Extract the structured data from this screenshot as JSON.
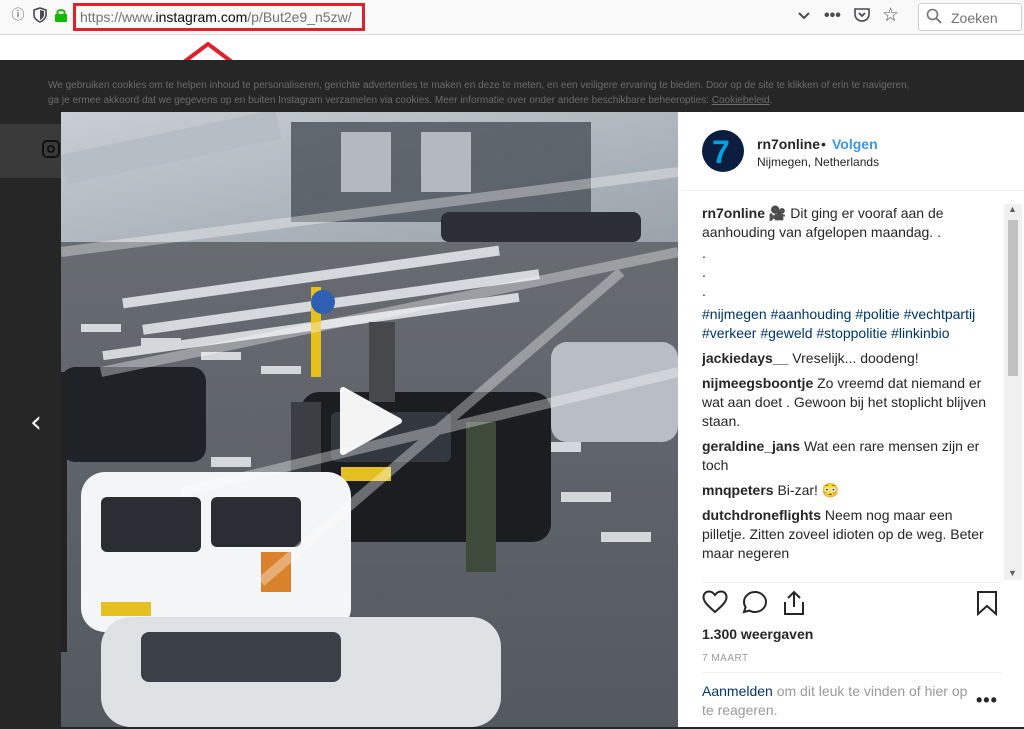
{
  "browser": {
    "url_prefix": "https://www.",
    "url_domain": "instagram.com",
    "url_path": "/p/But2e9_n5zw/",
    "search_placeholder": "Zoeken"
  },
  "cookie_banner": {
    "line1": "We gebruiken cookies om te helpen inhoud te personaliseren, gerichte advertenties te maken en deze te meten, en een veiligere ervaring te bieden. Door op de site te klikken of erin te navigeren,",
    "line2": "ga je ermee akkoord dat we gegevens op en buiten Instagram verzamelen via cookies. Meer informatie over onder andere beschikbare beheeropties: ",
    "link": "Cookiebeleid",
    "line2_end": "."
  },
  "post": {
    "username": "rn7online",
    "separator": "•",
    "follow_label": "Volgen",
    "location": "Nijmegen, Netherlands",
    "avatar_glyph": "7",
    "caption_user": "rn7online",
    "caption_text": "🎥 Dit ging er vooraf aan de aanhouding van afgelopen maandag. .",
    "caption_dots": [
      ".",
      ".",
      "."
    ],
    "hashtags": "#nijmegen #aanhouding #politie #vechtpartij #verkeer #geweld #stoppolitie #linkinbio",
    "comments": [
      {
        "user": "jackiedays__",
        "text": "Vreselijk... doodeng!"
      },
      {
        "user": "nijmeegsboontje",
        "text": "Zo vreemd dat niemand er wat aan doet . Gewoon bij het stoplicht blijven staan."
      },
      {
        "user": "geraldine_jans",
        "text": "Wat een rare mensen zijn er toch"
      },
      {
        "user": "mnqpeters",
        "text": "Bi-zar! 😳"
      },
      {
        "user": "dutchdroneflights",
        "text": "Neem nog maar een pilletje. Zitten zoveel idioten op de weg. Beter maar negeren"
      }
    ],
    "views": "1.300 weergaven",
    "date": "7 MAART",
    "login_link": "Aanmelden",
    "login_text": " om dit leuk te vinden of hier op te reageren.",
    "more_label": "•••"
  },
  "icons": [
    "info-icon",
    "shield-icon",
    "lock-icon",
    "chevron-down-icon",
    "more-icon",
    "pocket-icon",
    "star-icon",
    "search-icon",
    "instagram-icon",
    "chevron-left-icon",
    "play-icon",
    "heart-icon",
    "comment-icon",
    "share-icon",
    "bookmark-icon"
  ],
  "colors": {
    "highlight": "#e0202b",
    "overlay": "#262626",
    "link_blue": "#3897f0",
    "hashtag": "#003569"
  }
}
